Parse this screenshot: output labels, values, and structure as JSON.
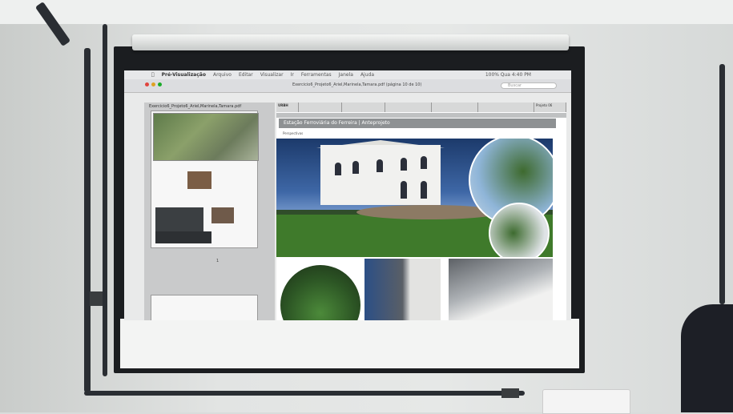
{
  "menubar": {
    "apple": "",
    "app_name": "Pré-Visualização",
    "items": [
      "Arquivo",
      "Editar",
      "Visualizar",
      "Ir",
      "Ferramentas",
      "Janela",
      "Ajuda"
    ],
    "battery": "100%",
    "clock": "Qua 4:40 PM"
  },
  "window": {
    "title": "Exercicio6_Projeto6_Ariel,Marinela,Tamara.pdf (página 10 de 10)",
    "search_placeholder": "Buscar"
  },
  "sidebar": {
    "file_name": "Exercicio6_Projeto6_Ariel,Marinela,Tamara.pdf",
    "page_number": "1"
  },
  "document": {
    "header_title": "Exercicio6_Projeto6_Ariel,Marinela,Tamara.pdf (página 10 de 10)",
    "header_cells": [
      "URBH",
      "",
      "",
      "",
      "",
      "",
      "Projeto 06"
    ],
    "section_title": "Estação Ferroviária do Ferreira | Anteprojeto",
    "section_label": "Perspectivas"
  },
  "colors": {
    "screen_frame": "#1b1d20",
    "projection_bg": "#e9eaea",
    "title_bar": "#8e9193",
    "wall": "#e2e4e3"
  }
}
